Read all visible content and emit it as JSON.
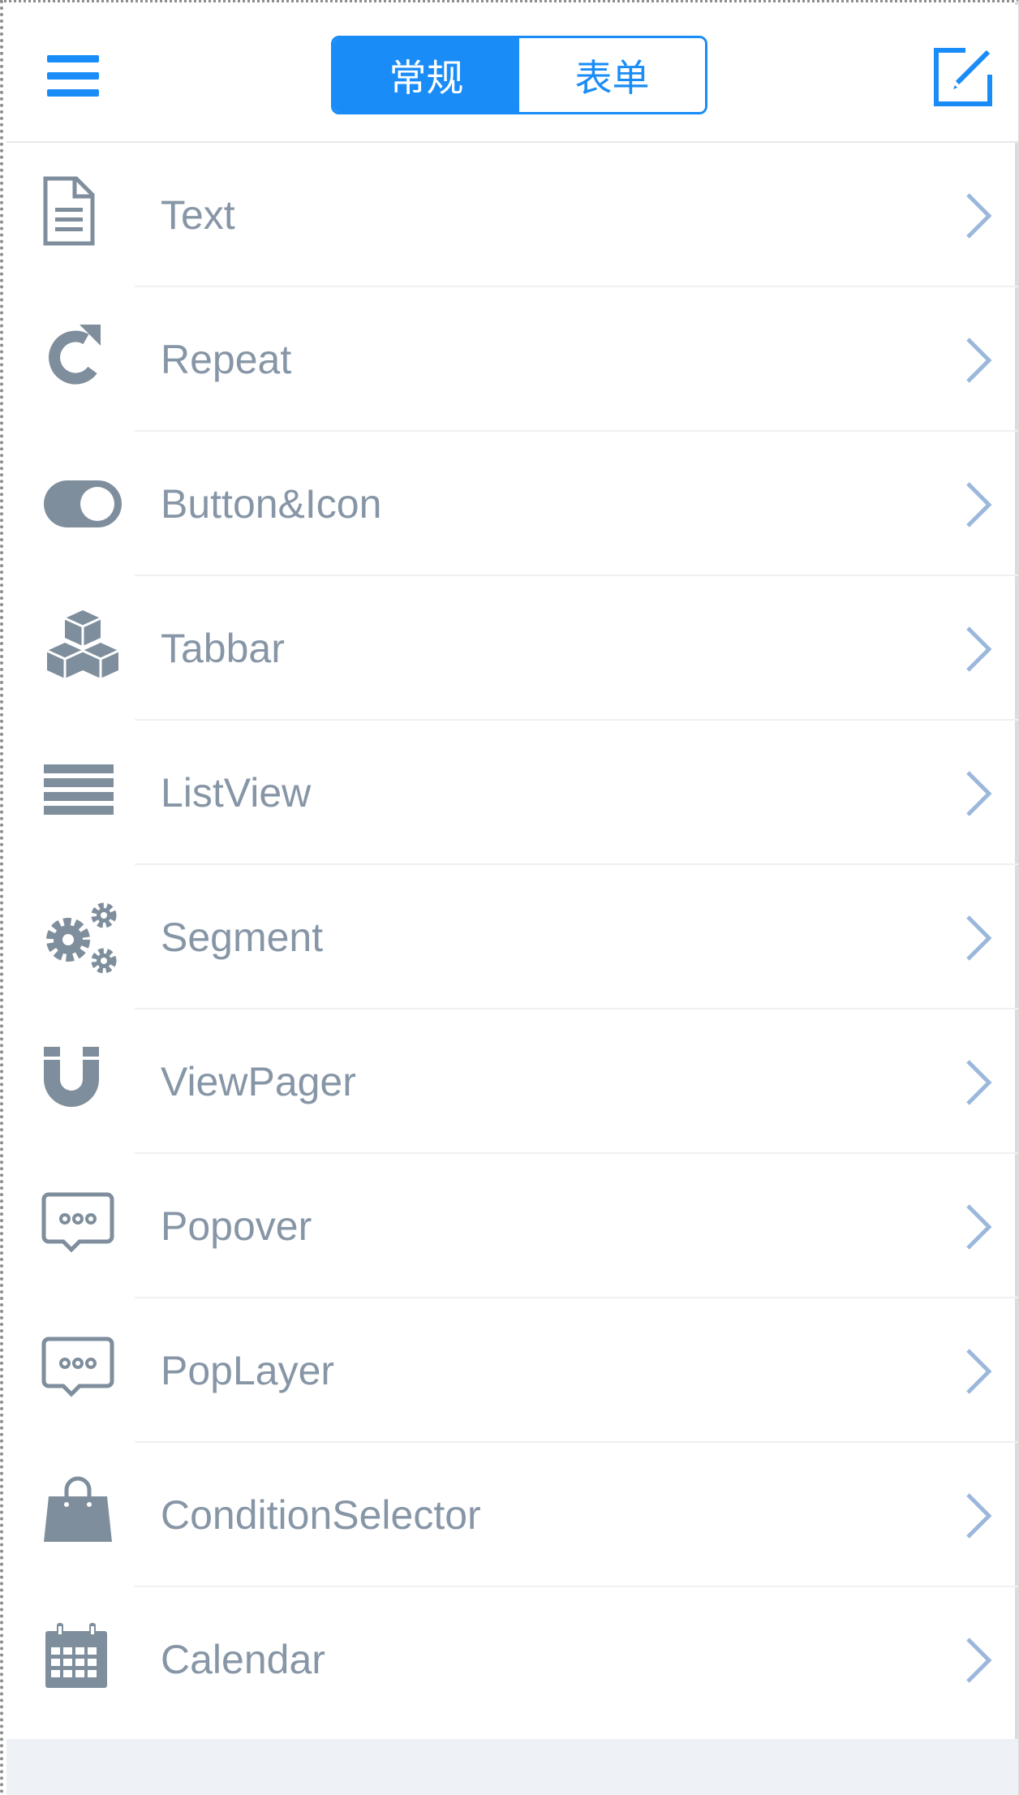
{
  "header": {
    "menu_icon": "hamburger-menu-icon",
    "edit_icon": "edit-icon",
    "segments": [
      {
        "label": "常规",
        "active": true
      },
      {
        "label": "表单",
        "active": false
      }
    ]
  },
  "list": {
    "items": [
      {
        "label": "Text",
        "icon": "document-icon"
      },
      {
        "label": "Repeat",
        "icon": "refresh-icon"
      },
      {
        "label": "Button&Icon",
        "icon": "toggle-icon"
      },
      {
        "label": "Tabbar",
        "icon": "cubes-icon"
      },
      {
        "label": "ListView",
        "icon": "list-icon"
      },
      {
        "label": "Segment",
        "icon": "gears-icon"
      },
      {
        "label": "ViewPager",
        "icon": "magnet-icon"
      },
      {
        "label": "Popover",
        "icon": "chat-bubble-icon"
      },
      {
        "label": "PopLayer",
        "icon": "chat-bubble-icon"
      },
      {
        "label": "ConditionSelector",
        "icon": "shopping-bag-icon"
      },
      {
        "label": "Calendar",
        "icon": "calendar-icon"
      }
    ]
  },
  "colors": {
    "accent": "#1a8cf7",
    "icon_gray": "#7f8e9c",
    "label_gray": "#8796a6",
    "chevron": "#9bb8dc",
    "divider": "#eef0f2",
    "footer_bg": "#eef1f5"
  }
}
